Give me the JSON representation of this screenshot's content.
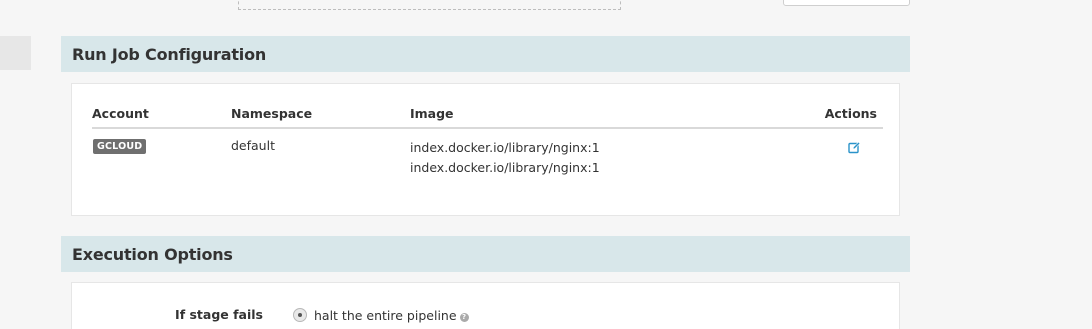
{
  "run_job": {
    "title": "Run Job Configuration",
    "columns": {
      "account": "Account",
      "namespace": "Namespace",
      "image": "Image",
      "actions": "Actions"
    },
    "rows": [
      {
        "account": "GCLOUD",
        "namespace": "default",
        "images": [
          "index.docker.io/library/nginx:1",
          "index.docker.io/library/nginx:1"
        ],
        "action_icon": "edit-icon"
      }
    ]
  },
  "execution_options": {
    "title": "Execution Options",
    "if_stage_fails": {
      "label": "If stage fails",
      "selected_option": "halt the entire pipeline",
      "help_icon": "question-icon"
    }
  },
  "colors": {
    "section_header_bg": "#d8e7ea",
    "accent": "#2a93c9",
    "badge_bg": "#6f6f6f"
  }
}
